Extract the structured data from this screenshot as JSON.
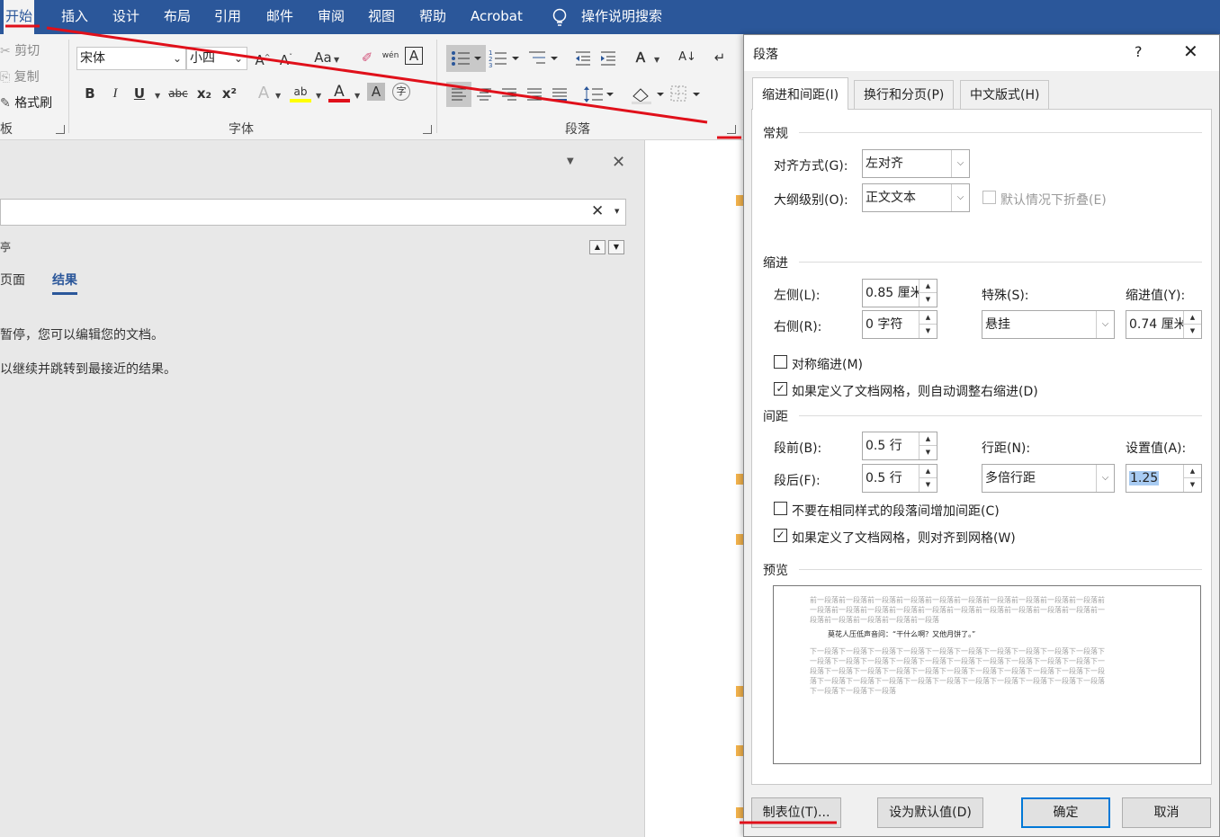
{
  "menubar": {
    "tabs": [
      "开始",
      "插入",
      "设计",
      "布局",
      "引用",
      "邮件",
      "审阅",
      "视图",
      "帮助",
      "Acrobat"
    ],
    "search_label": "操作说明搜索"
  },
  "ribbon": {
    "clipboard": {
      "cut": "剪切",
      "copy": "复制",
      "format_painter": "格式刷",
      "label": "板"
    },
    "font": {
      "name": "宋体",
      "size": "小四",
      "label": "字体",
      "bold": "B",
      "italic": "I",
      "underline": "U",
      "strike": "abc",
      "subscript": "x₂",
      "superscript": "x²",
      "case": "Aa",
      "phonetic": "wén",
      "text_effect": "A",
      "font_color": "A",
      "char_shade": "A",
      "enclose": "字",
      "highlight": "ab"
    },
    "paragraph": {
      "label": "段落"
    }
  },
  "nav_pane": {
    "header_partial": "亭",
    "tabs": [
      "页面",
      "结果"
    ],
    "message_1": "暂停，您可以编辑您的文档。",
    "message_2": "以继续并跳转到最接近的结果。"
  },
  "dialog": {
    "title": "段落",
    "help": "?",
    "close": "✕",
    "tabs": [
      "缩进和间距(I)",
      "换行和分页(P)",
      "中文版式(H)"
    ],
    "general": {
      "title": "常规",
      "alignment_label": "对齐方式(G):",
      "alignment_value": "左对齐",
      "outline_label": "大纲级别(O):",
      "outline_value": "正文文本",
      "collapse_label": "默认情况下折叠(E)"
    },
    "indent": {
      "title": "缩进",
      "left_label": "左侧(L):",
      "left_value": "0.85 厘米",
      "right_label": "右侧(R):",
      "right_value": "0 字符",
      "special_label": "特殊(S):",
      "special_value": "悬挂",
      "by_label": "缩进值(Y):",
      "by_value": "0.74 厘米",
      "mirror_label": "对称缩进(M)",
      "mirror_checked": false,
      "auto_right_label": "如果定义了文档网格，则自动调整右缩进(D)",
      "auto_right_checked": true
    },
    "spacing": {
      "title": "间距",
      "before_label": "段前(B):",
      "before_value": "0.5 行",
      "after_label": "段后(F):",
      "after_value": "0.5 行",
      "line_label": "行距(N):",
      "line_value": "多倍行距",
      "at_label": "设置值(A):",
      "at_value": "1.25",
      "no_space_label": "不要在相同样式的段落间增加间距(C)",
      "no_space_checked": false,
      "snap_grid_label": "如果定义了文档网格，则对齐到网格(W)",
      "snap_grid_checked": true
    },
    "preview": {
      "title": "预览",
      "prev_lines": [
        "前一段落前一段落前一段落前一段落前一段落前一段落前一段落前一段落前一段落前一段落前",
        "一段落前一段落前一段落前一段落前一段落前一段落前一段落前一段落前一段落前一段落前一",
        "段落前一段落前一段落前一段落前一段落"
      ],
      "body": "莫花人压低声音问：“干什么啊？又他月饼了。”",
      "next_lines": [
        "下一段落下一段落下一段落下一段落下一段落下一段落下一段落下一段落下一段落下一段落下",
        "一段落下一段落下一段落下一段落下一段落下一段落下一段落下一段落下一段落下一段落下一",
        "段落下一段落下一段落下一段落下一段落下一段落下一段落下一段落下一段落下一段落下一段",
        "落下一段落下一段落下一段落下一段落下一段落下一段落下一段落下一段落下一段落下一段落",
        "下一段落下一段落下一段落"
      ]
    },
    "buttons": {
      "tabs": "制表位(T)...",
      "default": "设为默认值(D)",
      "ok": "确定",
      "cancel": "取消"
    }
  },
  "colors": {
    "ribbon_blue": "#2b579a",
    "annotation_red": "#e0101a",
    "focus_blue": "#0078d7"
  }
}
